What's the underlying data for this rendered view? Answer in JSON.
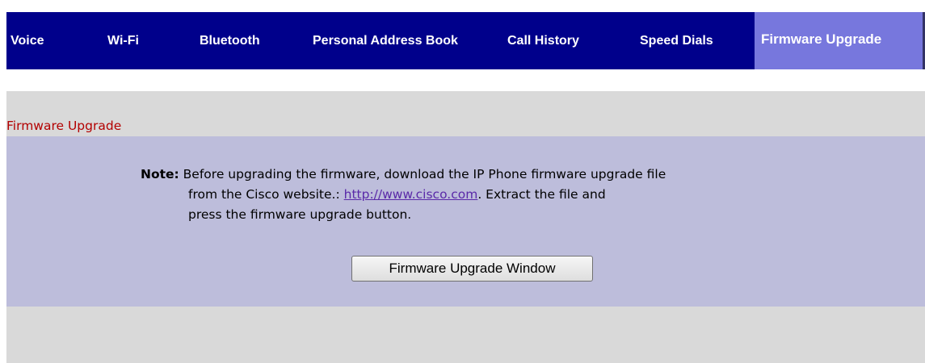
{
  "nav": {
    "tabs": [
      {
        "label": "Voice",
        "active": false
      },
      {
        "label": "Wi-Fi",
        "active": false
      },
      {
        "label": "Bluetooth",
        "active": false
      },
      {
        "label": "Personal Address Book",
        "active": false
      },
      {
        "label": "Call History",
        "active": false
      },
      {
        "label": "Speed Dials",
        "active": false
      },
      {
        "label": "Firmware Upgrade",
        "active": true
      }
    ]
  },
  "page": {
    "title": "Firmware Upgrade"
  },
  "note": {
    "label": "Note:",
    "line1": " Before upgrading the firmware, download the IP Phone firmware upgrade file",
    "line2_before": "from the Cisco website.: ",
    "link_text": "http://www.cisco.com",
    "line2_after": ". Extract the file and",
    "line3": "press the firmware upgrade button."
  },
  "actions": {
    "upgrade_window_button": "Firmware Upgrade Window"
  },
  "colors": {
    "nav_background": "#00008b",
    "active_tab": "#7777dd",
    "panel_background": "#bdbddb",
    "content_background": "#d9d9d9",
    "title_color": "#b30000",
    "link_color": "#5a2aa8"
  }
}
